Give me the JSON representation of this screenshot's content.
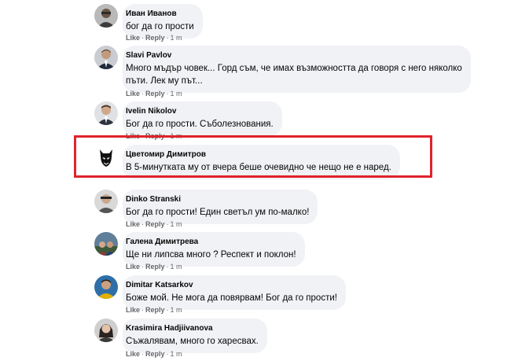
{
  "action_labels": {
    "like": "Like",
    "reply": "Reply",
    "separator": "·"
  },
  "comments": [
    {
      "author": "Иван Иванов",
      "text_lines": [
        "бог да го прости"
      ],
      "time": "1 m"
    },
    {
      "author": "Slavi Pavlov",
      "text_lines": [
        "Много мъдър човек... Горд съм, че имах възможността да говоря с него няколко",
        "пъти. Лек му път..."
      ],
      "time": "1 m"
    },
    {
      "author": "Ivelin Nikolov",
      "text_lines": [
        "Бог да го прости. Съболезнования."
      ],
      "time": "1 m"
    },
    {
      "author": "Цветомир Димитров",
      "text_lines": [
        "В 5-минутката му от вчера беше очевидно че нещо не е наред."
      ],
      "time": ""
    },
    {
      "author": "Dinko Stranski",
      "text_lines": [
        "Бог да го прости! Един светъл ум по-малко!"
      ],
      "time": "1 m"
    },
    {
      "author": "Галена Димитрева",
      "text_lines": [
        "Ще ни липсва много ? Респект и поклон!"
      ],
      "time": "1 m"
    },
    {
      "author": "Dimitar Katsarkov",
      "text_lines": [
        "Боже мой. Не мога да повярвам! Бог да го прости!"
      ],
      "time": "1 m"
    },
    {
      "author": "Krasimira Hadjiivanova",
      "text_lines": [
        "Съжалявам, много го харесвах."
      ],
      "time": "1 m"
    }
  ],
  "colors": {
    "bubble": "#f0f2f5",
    "highlight_border": "#e0232b",
    "meta_text": "#65676b",
    "body_text": "#050505"
  }
}
